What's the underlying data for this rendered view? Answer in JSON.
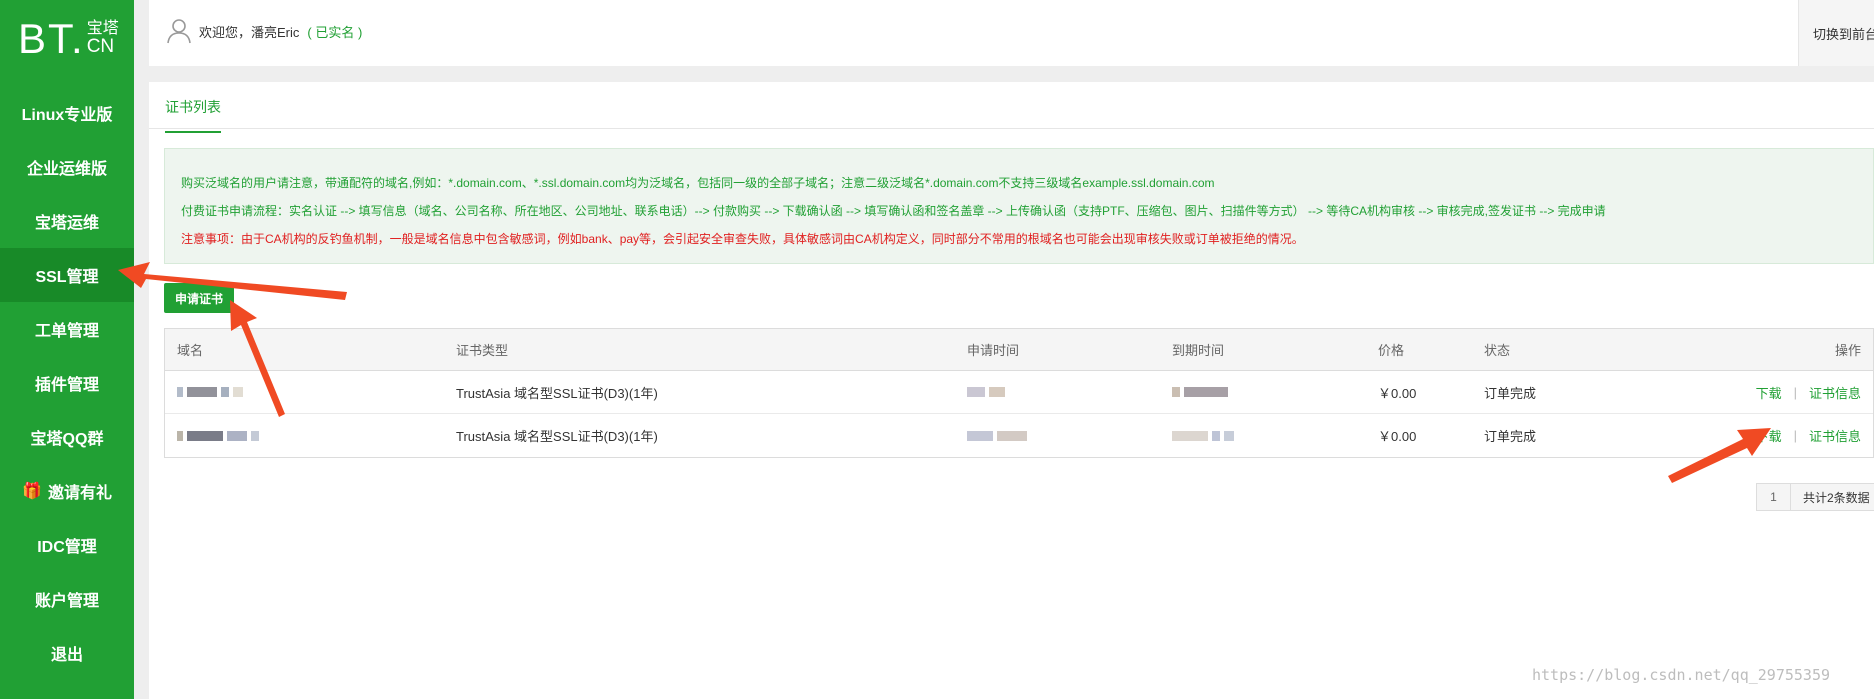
{
  "brand": {
    "logo_big": "BT.",
    "logo_cn_top": "宝塔",
    "logo_cn_bottom": "CN"
  },
  "sidebar": {
    "items": [
      {
        "label": "Linux专业版"
      },
      {
        "label": "企业运维版"
      },
      {
        "label": "宝塔运维"
      },
      {
        "label": "SSL管理",
        "active": true
      },
      {
        "label": "工单管理"
      },
      {
        "label": "插件管理"
      },
      {
        "label": "宝塔QQ群"
      },
      {
        "label": "邀请有礼",
        "icon": "gift-icon"
      },
      {
        "label": "IDC管理"
      },
      {
        "label": "账户管理"
      },
      {
        "label": "退出"
      }
    ]
  },
  "header": {
    "greeting": "欢迎您，",
    "username": "潘亮Eric",
    "verified": "( 已实名 )",
    "switch_label": "切换到前台"
  },
  "tabs": [
    {
      "label": "证书列表"
    }
  ],
  "notice": {
    "line1": "购买泛域名的用户请注意，带通配符的域名,例如：*.domain.com、*.ssl.domain.com均为泛域名，包括同一级的全部子域名；注意二级泛域名*.domain.com不支持三级域名example.ssl.domain.com",
    "line2": "付费证书申请流程：实名认证 --> 填写信息（域名、公司名称、所在地区、公司地址、联系电话）--> 付款购买 --> 下载确认函 --> 填写确认函和签名盖章 --> 上传确认函（支持PTF、压缩包、图片、扫描件等方式） --> 等待CA机构审核 --> 审核完成,签发证书 --> 完成申请",
    "line3": "注意事项：由于CA机构的反钓鱼机制，一般是域名信息中包含敏感词，例如bank、pay等，会引起安全审查失败，具体敏感词由CA机构定义，同时部分不常用的根域名也可能会出现审核失败或订单被拒绝的情况。"
  },
  "apply_button": "申请证书",
  "table": {
    "columns": [
      "域名",
      "证书类型",
      "申请时间",
      "到期时间",
      "价格",
      "状态",
      "操作"
    ],
    "rows": [
      {
        "cert_type": "TrustAsia 域名型SSL证书(D3)(1年)",
        "price": "￥0.00",
        "status": "订单完成",
        "download": "下载",
        "info": "证书信息"
      },
      {
        "cert_type": "TrustAsia 域名型SSL证书(D3)(1年)",
        "price": "￥0.00",
        "status": "订单完成",
        "download": "下载",
        "info": "证书信息"
      }
    ]
  },
  "pagination": {
    "page": "1",
    "total": "共计2条数据"
  },
  "watermark": "https://blog.csdn.net/qq_29755359",
  "colors": {
    "brand_green": "#21a034",
    "sidebar_active": "#188a28",
    "warning_red": "#e02020",
    "annotation_arrow": "#f04a23"
  }
}
